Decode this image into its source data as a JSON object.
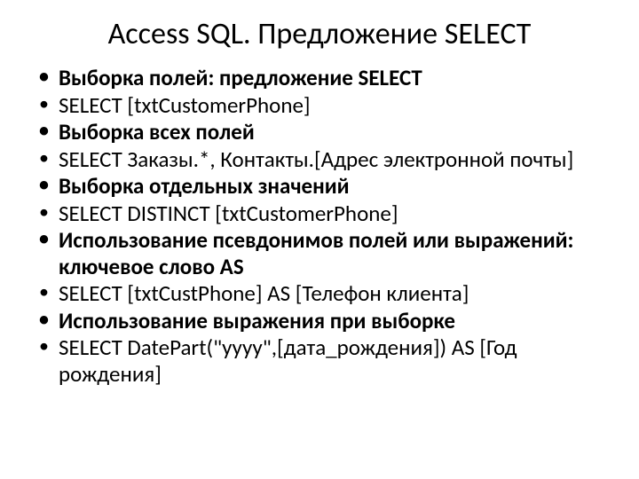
{
  "title": "Access SQL. Предложение SELECT",
  "items": [
    {
      "text": "Выборка полей: предложение SELECT",
      "bold": true
    },
    {
      "text": "SELECT [txtCustomerPhone]",
      "bold": false
    },
    {
      "text": "Выборка всех полей",
      "bold": true
    },
    {
      "text": "SELECT Заказы.*, Контакты.[Адрес электронной почты]",
      "bold": false
    },
    {
      "text": "Выборка отдельных значений",
      "bold": true
    },
    {
      "text": "SELECT DISTINCT [txtCustomerPhone]",
      "bold": false
    },
    {
      "text": "Использование псевдонимов полей или выражений: ключевое слово AS",
      "bold": true
    },
    {
      "text": "SELECT [txtCustPhone] AS [Телефон клиента]",
      "bold": false
    },
    {
      "text": "Использование выражения при выборке",
      "bold": true
    },
    {
      "text": "SELECT DatePart(\"yyyy\",[дата_рождения]) AS [Год рождения]",
      "bold": false
    }
  ]
}
